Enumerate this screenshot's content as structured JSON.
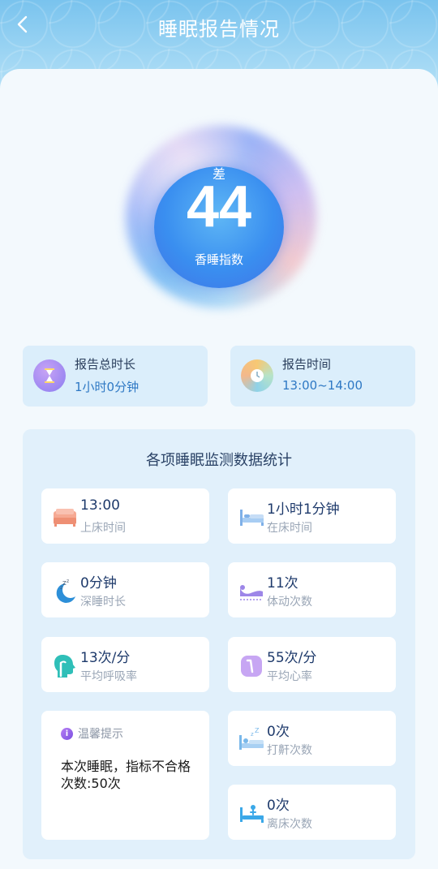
{
  "header": {
    "title": "睡眠报告情况"
  },
  "score": {
    "level": "差",
    "value": "44",
    "label": "香睡指数"
  },
  "summary": {
    "duration": {
      "title": "报告总时长",
      "value": "1小时0分钟"
    },
    "time": {
      "title": "报告时间",
      "value": "13:00~14:00"
    }
  },
  "stats": {
    "title": "各项睡眠监测数据统计",
    "bed_time": {
      "value": "13:00",
      "label": "上床时间"
    },
    "in_bed": {
      "value": "1小时1分钟",
      "label": "在床时间"
    },
    "deep_sleep": {
      "value": "0分钟",
      "label": "深睡时长"
    },
    "movement": {
      "value": "11次",
      "label": "体动次数"
    },
    "breathing": {
      "value": "13次/分",
      "label": "平均呼吸率"
    },
    "heart": {
      "value": "55次/分",
      "label": "平均心率"
    },
    "snore": {
      "value": "0次",
      "label": "打鼾次数"
    },
    "leave_bed": {
      "value": "0次",
      "label": "离床次数"
    }
  },
  "tip": {
    "title": "温馨提示",
    "body": "本次睡眠，指标不合格次数:50次"
  },
  "colors": {
    "accent": "#2e78c4",
    "header": "#79c3ee"
  }
}
